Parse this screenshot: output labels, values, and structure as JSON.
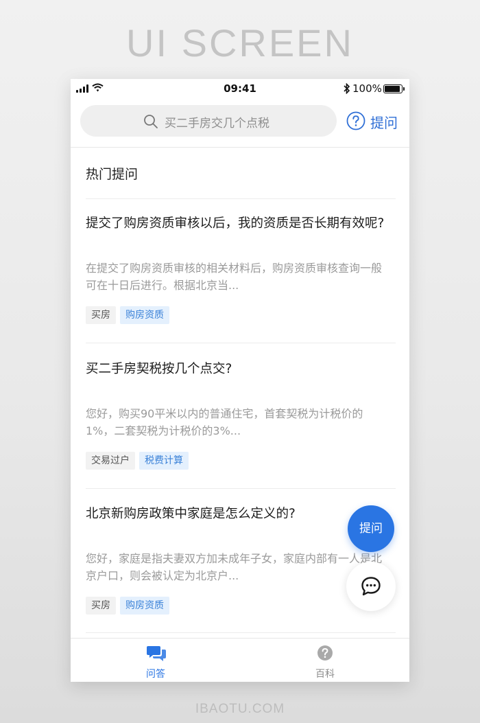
{
  "banner": {
    "title": "UI SCREEN",
    "footer": "IBAOTU.COM"
  },
  "status_bar": {
    "time": "09:41",
    "battery": "100%",
    "battery_level": 1.0
  },
  "search": {
    "placeholder": "买二手房交几个点税"
  },
  "header": {
    "ask_label": "提问"
  },
  "section": {
    "title": "热门提问"
  },
  "questions": [
    {
      "title": "提交了购房资质审核以后，我的资质是否长期有效呢?",
      "excerpt": "在提交了购房资质审核的相关材料后，购房资质审核查询一般可在十日后进行。根据北京当...",
      "tags": [
        "买房",
        "购房资质"
      ]
    },
    {
      "title": "买二手房契税按几个点交?",
      "excerpt": "您好，购买90平米以内的普通住宅，首套契税为计税价的1%，二套契税为计税价的3%...",
      "tags": [
        "交易过户",
        "税费计算"
      ]
    },
    {
      "title": "北京新购房政策中家庭是怎么定义的?",
      "excerpt": "您好，家庭是指夫妻双方加未成年子女，家庭内部有一人是北京户口，则会被认定为北京户...",
      "tags": [
        "买房",
        "购房资质"
      ]
    }
  ],
  "fab": {
    "ask_label": "提问"
  },
  "tab_bar": {
    "items": [
      {
        "label": "问答",
        "active": true
      },
      {
        "label": "百科",
        "active": false
      }
    ]
  },
  "colors": {
    "accent": "#2a75e3",
    "tag_blue_bg": "#e4f0fd",
    "tag_blue_text": "#3b82d8"
  },
  "icons": [
    "signal-icon",
    "wifi-icon",
    "bluetooth-icon",
    "battery-icon",
    "search-icon",
    "question-circle-icon",
    "chat-bubble-icon",
    "qa-chat-icon",
    "encyclopedia-icon"
  ]
}
